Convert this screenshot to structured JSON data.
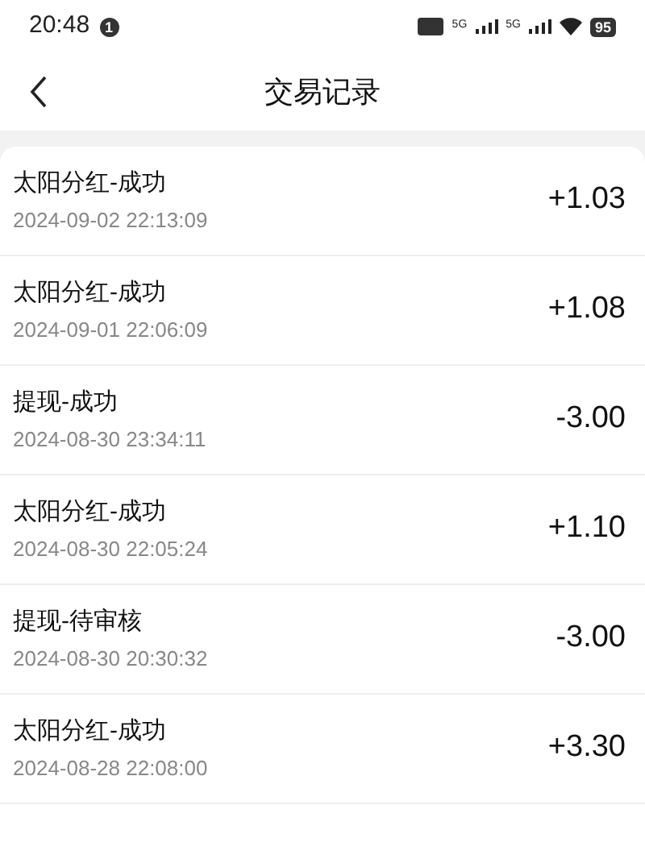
{
  "status_bar": {
    "time": "20:48",
    "notification_count": "1",
    "sim_1": "5G",
    "sim_2": "5G",
    "battery": "95"
  },
  "header": {
    "title": "交易记录"
  },
  "transactions": [
    {
      "title": "太阳分红-成功",
      "date": "2024-09-02 22:13:09",
      "amount": "+1.03"
    },
    {
      "title": "太阳分红-成功",
      "date": "2024-09-01 22:06:09",
      "amount": "+1.08"
    },
    {
      "title": "提现-成功",
      "date": "2024-08-30 23:34:11",
      "amount": "-3.00"
    },
    {
      "title": "太阳分红-成功",
      "date": "2024-08-30 22:05:24",
      "amount": "+1.10"
    },
    {
      "title": "提现-待审核",
      "date": "2024-08-30 20:30:32",
      "amount": "-3.00"
    },
    {
      "title": "太阳分红-成功",
      "date": "2024-08-28 22:08:00",
      "amount": "+3.30"
    }
  ]
}
